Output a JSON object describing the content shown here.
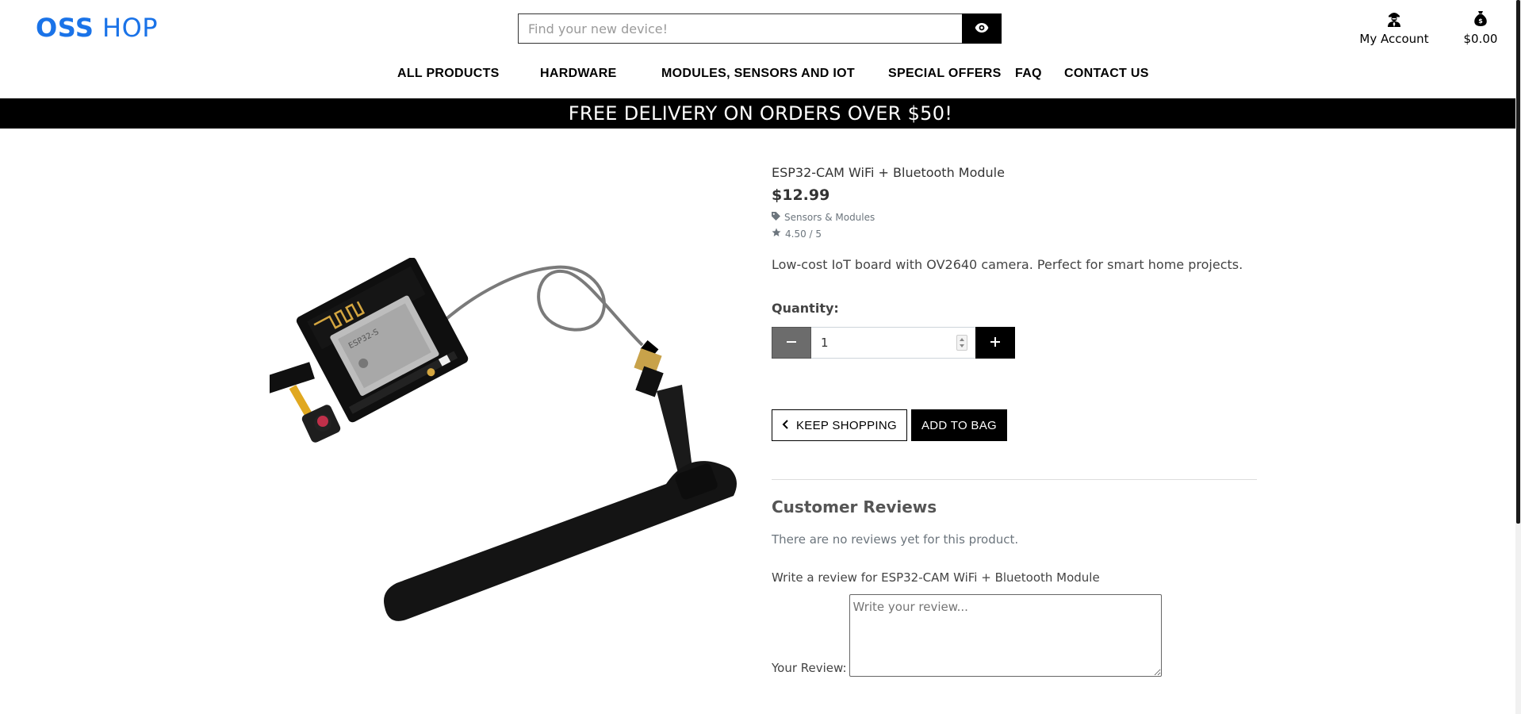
{
  "brand": {
    "logo_bold": "OSS",
    "logo_light": " HOP",
    "color": "#1a73e8"
  },
  "search": {
    "placeholder": "Find your new device!",
    "icon": "eye-icon"
  },
  "account": {
    "label": "My Account",
    "icon": "user-icon"
  },
  "bag": {
    "total": "$0.00",
    "icon": "money-bag-icon"
  },
  "nav": {
    "items": [
      {
        "label": "ALL PRODUCTS"
      },
      {
        "label": "HARDWARE"
      },
      {
        "label": "MODULES, SENSORS AND IOT"
      },
      {
        "label": "SPECIAL OFFERS"
      },
      {
        "label": "FAQ"
      },
      {
        "label": "CONTACT US"
      }
    ]
  },
  "banner": {
    "text": "FREE DELIVERY ON ORDERS OVER $50!"
  },
  "product": {
    "name": "ESP32-CAM WiFi + Bluetooth Module",
    "price": "$12.99",
    "category": "Sensors & Modules",
    "rating": "4.50 / 5",
    "description": "Low-cost IoT board with OV2640 camera. Perfect for smart home projects."
  },
  "quantity": {
    "label": "Quantity:",
    "value": "1"
  },
  "buttons": {
    "keep_shopping": "KEEP SHOPPING",
    "add_to_bag": "ADD TO BAG"
  },
  "reviews": {
    "title": "Customer Reviews",
    "empty": "There are no reviews yet for this product.",
    "write_title": "Write a review for ESP32-CAM WiFi + Bluetooth Module",
    "field_label": "Your Review:",
    "placeholder": "Write your review..."
  }
}
